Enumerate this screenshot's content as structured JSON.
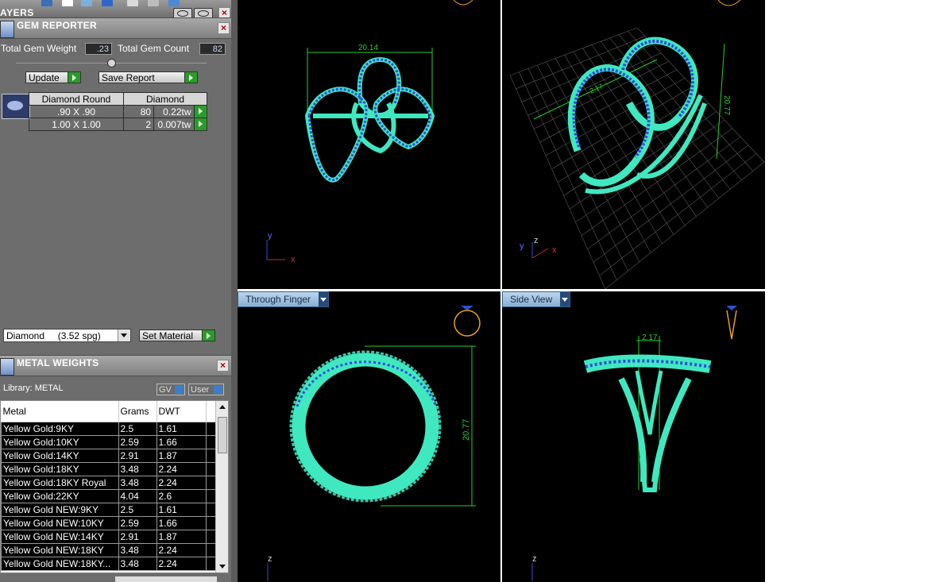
{
  "layers": {
    "title": "AYERS"
  },
  "gem_reporter": {
    "title": "GEM REPORTER",
    "total_weight_label": "Total Gem Weight",
    "total_weight_value": ".23",
    "total_count_label": "Total Gem Count",
    "total_count_value": "82",
    "update_label": "Update",
    "save_report_label": "Save Report",
    "table": {
      "headers": [
        "Diamond Round",
        "Diamond"
      ],
      "rows": [
        {
          "size": ".90 X .90",
          "count": "80",
          "weight": "0.22tw"
        },
        {
          "size": "1.00 X 1.00",
          "count": "2",
          "weight": "0.007tw"
        }
      ]
    },
    "material_select": "Diamond     (3.52 spg)",
    "set_material_label": "Set Material"
  },
  "metal_weights": {
    "title": "METAL WEIGHTS",
    "library_label": "Library: METAL",
    "gv_label": "GV",
    "user_label": "User",
    "columns": [
      "Metal",
      "Grams",
      "DWT"
    ],
    "rows": [
      {
        "metal": "Yellow Gold:9KY",
        "grams": "2.5",
        "dwt": "1.61"
      },
      {
        "metal": "Yellow Gold:10KY",
        "grams": "2.59",
        "dwt": "1.66"
      },
      {
        "metal": "Yellow Gold:14KY",
        "grams": "2.91",
        "dwt": "1.87"
      },
      {
        "metal": "Yellow Gold:18KY",
        "grams": "3.48",
        "dwt": "2.24"
      },
      {
        "metal": "Yellow Gold:18KY Royal",
        "grams": "3.48",
        "dwt": "2.24"
      },
      {
        "metal": "Yellow Gold:22KY",
        "grams": "4.04",
        "dwt": "2.6"
      },
      {
        "metal": "Yellow Gold NEW:9KY",
        "grams": "2.5",
        "dwt": "1.61"
      },
      {
        "metal": "Yellow Gold NEW:10KY",
        "grams": "2.59",
        "dwt": "1.66"
      },
      {
        "metal": "Yellow Gold NEW:14KY",
        "grams": "2.91",
        "dwt": "1.87"
      },
      {
        "metal": "Yellow Gold NEW:18KY",
        "grams": "3.48",
        "dwt": "2.24"
      },
      {
        "metal": "Yellow Gold NEW:18KY...",
        "grams": "3.48",
        "dwt": "2.24"
      }
    ]
  },
  "viewports": {
    "top": {
      "dimension": "20.14",
      "axis_x": "x",
      "axis_y": "y"
    },
    "perspective": {
      "dimension_a": "20.77",
      "dimension_b": "2.17",
      "axis_x": "x",
      "axis_y": "y",
      "axis_z": "z"
    },
    "front": {
      "label": "Through Finger",
      "dimension": "20.77",
      "axis_z": "z"
    },
    "side": {
      "label": "Side View",
      "dimension": "2.17",
      "axis_z": "z"
    }
  },
  "colors": {
    "metal": "#40e8c0",
    "gems": "#2f4fd8",
    "dimension": "#28d028",
    "viewport_bg": "#000000"
  }
}
